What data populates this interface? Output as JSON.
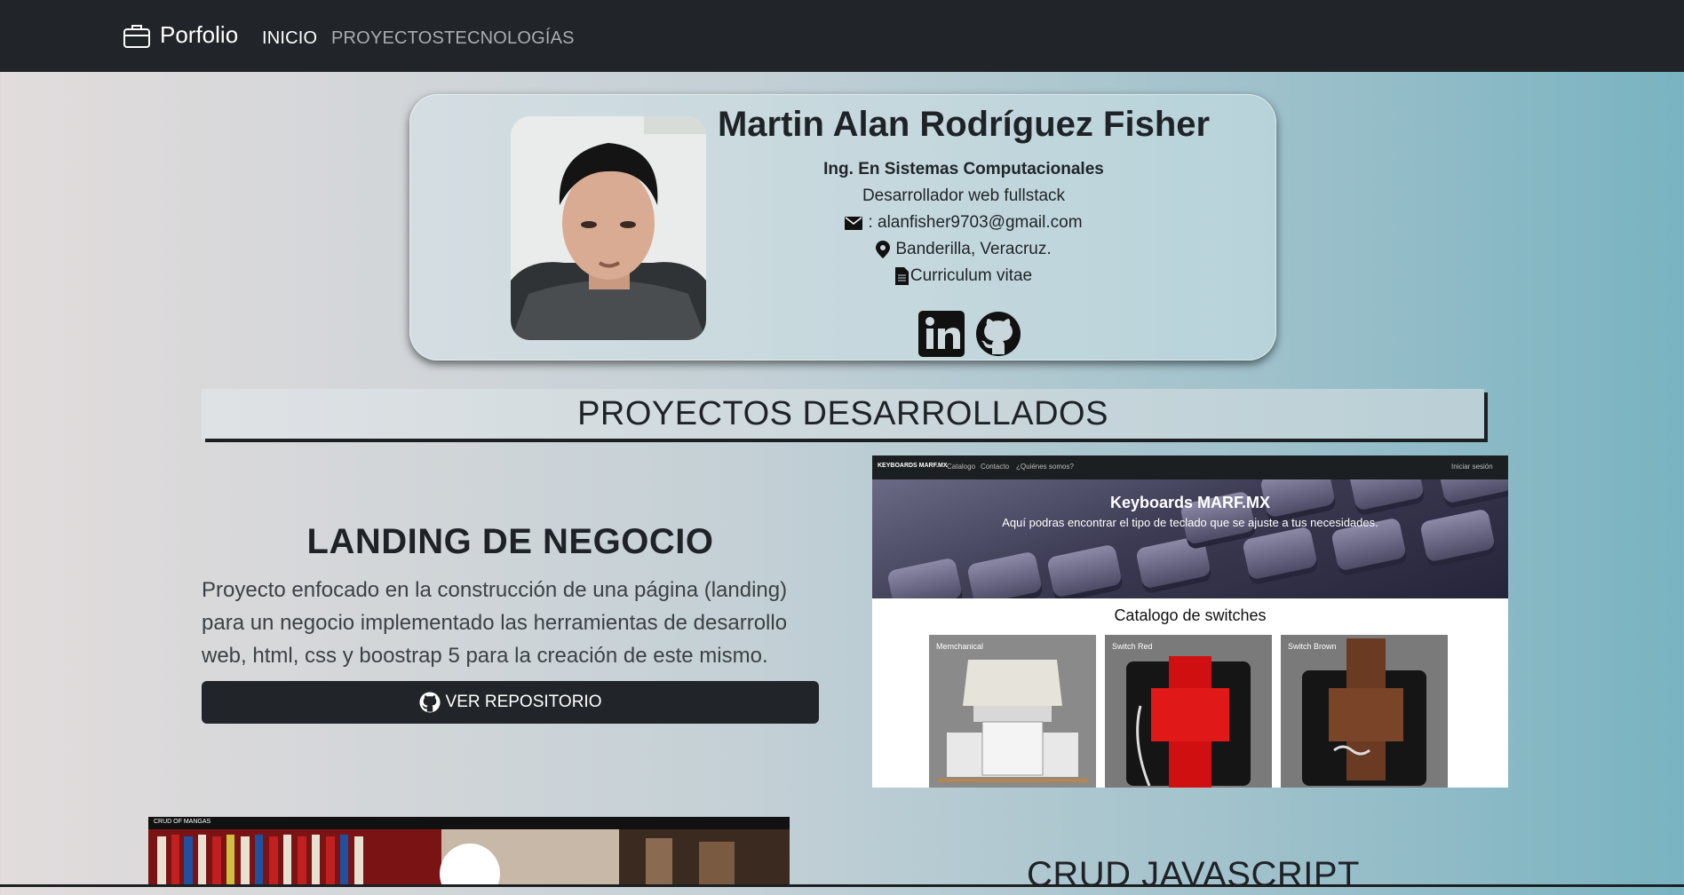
{
  "navbar": {
    "brand": "Porfolio",
    "links": [
      "INICIO",
      "PROYECTOS",
      "TECNOLOGÍAS"
    ],
    "active_index": 0
  },
  "profile": {
    "name": "Martin Alan Rodríguez Fisher",
    "degree": "Ing. En Sistemas Computacionales",
    "role": "Desarrollador web fullstack",
    "email": ": alanfisher9703@gmail.com",
    "location": "Banderilla, Veracruz.",
    "cv": "Curriculum vitae",
    "socials": [
      "linkedin-icon",
      "github-icon"
    ]
  },
  "projects_section": {
    "title": "PROYECTOS DESARROLLADOS"
  },
  "projects": [
    {
      "title": "LANDING DE NEGOCIO",
      "description": "Proyecto enfocado en la construcción de una página (landing) para un negocio implementado las herramientas de desarrollo web, html, css y boostrap 5 para la creación de este mismo.",
      "button": "VER REPOSITORIO",
      "preview": {
        "brand": "KEYBOARDS MARF.MX",
        "nav": [
          "Catalogo",
          "Contacto",
          "¿Quiénes somos?"
        ],
        "login": "Iniciar sesión",
        "hero_title": "Keyboards MARF.MX",
        "hero_sub": "Aquí podras encontrar el tipo de teclado que se ajuste a tus necesidades.",
        "catalog_title": "Catalogo de switches",
        "cards": [
          "Memchanical",
          "Switch Red",
          "Switch Brown"
        ]
      }
    },
    {
      "title": "CRUD JAVASCRIPT",
      "preview": {
        "brand": "CRUD OF MANGAS"
      }
    }
  ],
  "colors": {
    "navbar": "#212529",
    "button": "#212529",
    "accent_gradient_end": "#79b3c1"
  }
}
